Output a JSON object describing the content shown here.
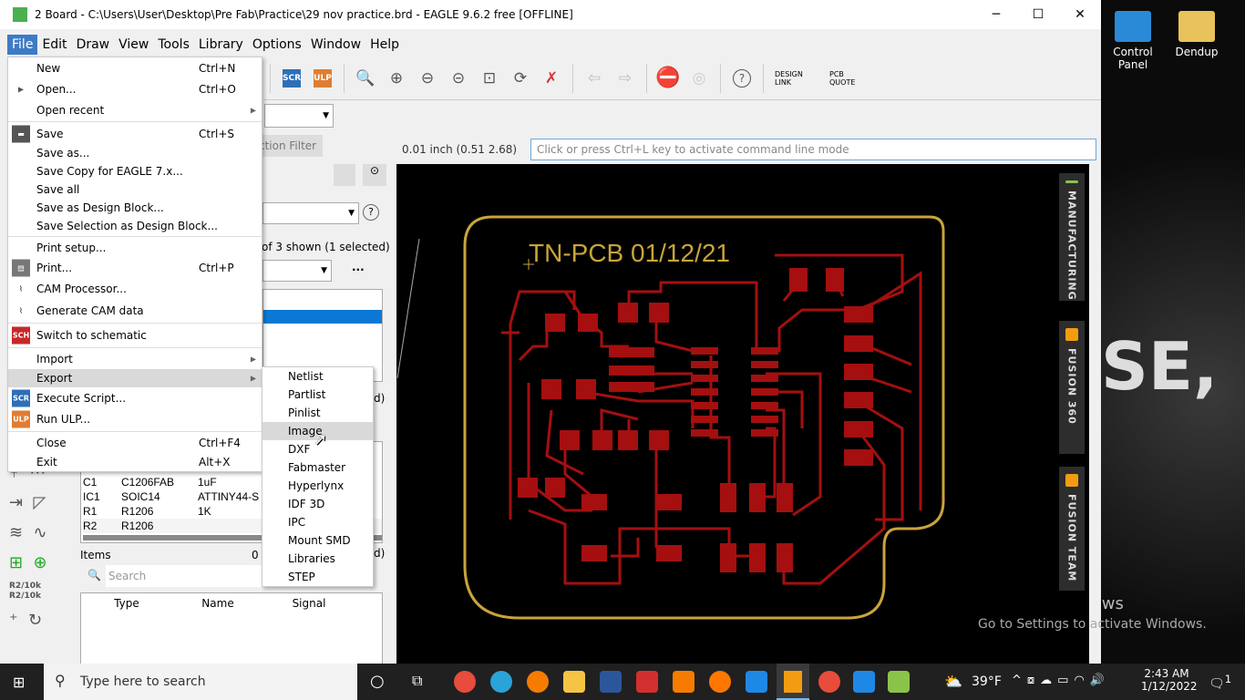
{
  "window": {
    "title": "2 Board - C:\\Users\\User\\Desktop\\Pre Fab\\Practice\\29 nov practice.brd - EAGLE 9.6.2 free [OFFLINE]"
  },
  "menubar": [
    "File",
    "Edit",
    "Draw",
    "View",
    "Tools",
    "Library",
    "Options",
    "Window",
    "Help"
  ],
  "toolbar": {
    "scr": "SCR",
    "ulp": "ULP",
    "design_link": "DESIGN LINK",
    "pcb_quote": "PCB QUOTE",
    "help": "?"
  },
  "coord": "0.01 inch (0.51 2.68)",
  "command_placeholder": "Click or press Ctrl+L key to activate command line mode",
  "left_panel": {
    "tab_partial": "ction Filter",
    "shown": "of 3 shown (1 selected)",
    "help": "?",
    "more": "...",
    "d1": "d)",
    "d2": "d)",
    "parts": [
      [
        "C1",
        "C1206FAB",
        "1uF"
      ],
      [
        "IC1",
        "SOIC14",
        "ATTINY44-S"
      ],
      [
        "R1",
        "R1206",
        "1K"
      ],
      [
        "R2",
        "R1206",
        ""
      ]
    ],
    "items_label": "Items",
    "items_count": "0",
    "search_placeholder": "Search",
    "columns": [
      "Type",
      "Name",
      "Signal"
    ],
    "tool_r2a": "R2",
    "tool_10ka": "10k",
    "tool_r2b": "R2",
    "tool_10kb": "10k"
  },
  "file_menu": [
    {
      "label": "New",
      "shortcut": "Ctrl+N"
    },
    {
      "label": "Open...",
      "shortcut": "Ctrl+O",
      "icon": "open-icon"
    },
    {
      "label": "Open recent",
      "submenu": true,
      "sep_after": true
    },
    {
      "label": "Save",
      "shortcut": "Ctrl+S",
      "icon": "save-icon"
    },
    {
      "label": "Save as..."
    },
    {
      "label": "Save Copy for EAGLE 7.x..."
    },
    {
      "label": "Save all"
    },
    {
      "label": "Save as Design Block..."
    },
    {
      "label": "Save Selection as Design Block...",
      "sep_after": true
    },
    {
      "label": "Print setup..."
    },
    {
      "label": "Print...",
      "shortcut": "Ctrl+P",
      "icon": "print-icon"
    },
    {
      "label": "CAM Processor...",
      "icon": "cam-icon"
    },
    {
      "label": "Generate CAM data",
      "icon": "cam-data-icon",
      "sep_after": true
    },
    {
      "label": "Switch to schematic",
      "icon": "schematic-icon",
      "sep_after": true
    },
    {
      "label": "Import",
      "submenu": true
    },
    {
      "label": "Export",
      "submenu": true,
      "highlighted": true
    },
    {
      "label": "Execute Script...",
      "icon": "scr-icon"
    },
    {
      "label": "Run ULP...",
      "icon": "ulp-icon",
      "sep_after": true
    },
    {
      "label": "Close",
      "shortcut": "Ctrl+F4"
    },
    {
      "label": "Exit",
      "shortcut": "Alt+X"
    }
  ],
  "export_menu": [
    "Netlist",
    "Partlist",
    "Pinlist",
    "Image",
    "DXF",
    "Fabmaster",
    "Hyperlynx",
    "IDF 3D",
    "IPC",
    "Mount SMD",
    "Libraries",
    "STEP"
  ],
  "export_highlighted": "Image",
  "board_label": "TN-PCB 01/12/21",
  "side_tabs": [
    "MANUFACTURING",
    "FUSION 360",
    "FUSION TEAM"
  ],
  "desktop": {
    "icons": [
      "Control Panel",
      "Dendup"
    ],
    "activate_title": "Activate Windows",
    "activate_sub": "Go to Settings to activate Windows.",
    "bg_text": "SE,"
  },
  "taskbar": {
    "search_placeholder": "Type here to search",
    "weather": "39°F",
    "time": "2:43 AM",
    "date": "1/12/2022",
    "notifications": "1"
  },
  "colors": {
    "pcb_trace": "#a50f0f",
    "board_outline": "#c9a43b",
    "menu_highlight": "#3d7bc6"
  }
}
